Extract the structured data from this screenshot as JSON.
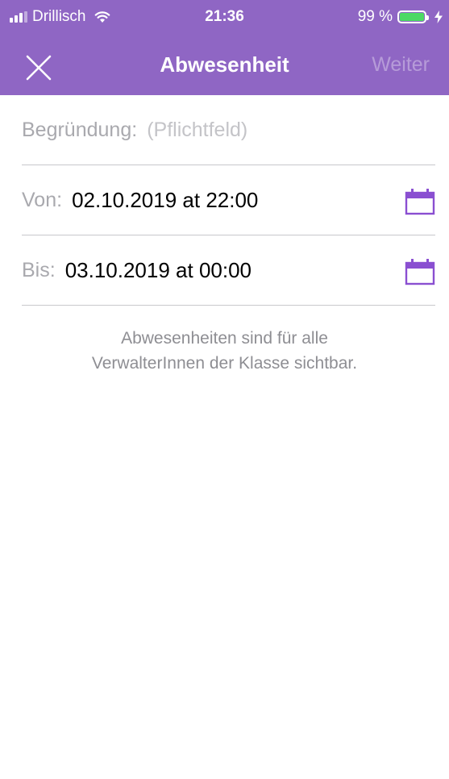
{
  "status_bar": {
    "carrier": "Drillisch",
    "time": "21:36",
    "battery_text": "99 %",
    "battery_level": 0.99,
    "signal_bars_filled": 3,
    "signal_bars_total": 4
  },
  "nav": {
    "title": "Abwesenheit",
    "next_label": "Weiter",
    "close_icon": "close-icon"
  },
  "form": {
    "reason": {
      "label": "Begründung:",
      "placeholder": "(Pflichtfeld)"
    },
    "from": {
      "label": "Von:",
      "value": "02.10.2019 at 22:00",
      "icon": "calendar-icon"
    },
    "to": {
      "label": "Bis:",
      "value": "03.10.2019 at 00:00",
      "icon": "calendar-icon"
    }
  },
  "note": {
    "line1": "Abwesenheiten sind für alle",
    "line2": "VerwalterInnen der Klasse sichtbar."
  },
  "colors": {
    "accent": "#8f66c4",
    "calendar_icon": "#8a4fd1",
    "battery_fill": "#4cd964"
  }
}
